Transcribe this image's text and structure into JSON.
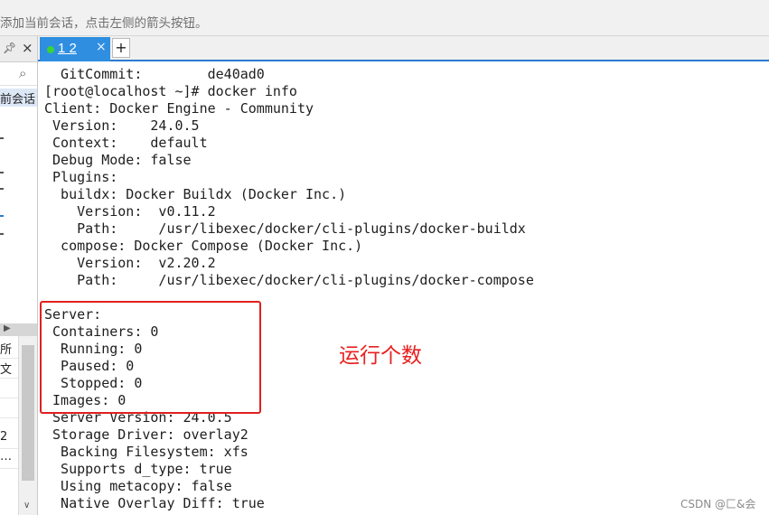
{
  "hint_bar": {
    "text": "添加当前会话，点击左侧的箭头按钮。"
  },
  "left_panel": {
    "pin_icon": "pin-icon",
    "close_glyph": "×",
    "pin_glyph": "▣",
    "search_glyph": "🔍",
    "session_label": "前会话",
    "list_items": [
      "所",
      "文",
      "",
      "",
      "2",
      "…"
    ]
  },
  "tabs": {
    "active_label": "1 2",
    "active_status_color": "#38d438",
    "close_glyph": "×",
    "add_glyph": "+"
  },
  "terminal": {
    "lines": [
      "  GitCommit:        de40ad0",
      "[root@localhost ~]# docker info",
      "Client: Docker Engine - Community",
      " Version:    24.0.5",
      " Context:    default",
      " Debug Mode: false",
      " Plugins:",
      "  buildx: Docker Buildx (Docker Inc.)",
      "    Version:  v0.11.2",
      "    Path:     /usr/libexec/docker/cli-plugins/docker-buildx",
      "  compose: Docker Compose (Docker Inc.)",
      "    Version:  v2.20.2",
      "    Path:     /usr/libexec/docker/cli-plugins/docker-compose",
      "",
      "Server:",
      " Containers: 0",
      "  Running: 0",
      "  Paused: 0",
      "  Stopped: 0",
      " Images: 0",
      " Server Version: 24.0.5",
      " Storage Driver: overlay2",
      "  Backing Filesystem: xfs",
      "  Supports d_type: true",
      "  Using metacopy: false",
      "  Native Overlay Diff: true"
    ]
  },
  "annotation": {
    "text": "运行个数",
    "color": "#e82020"
  },
  "watermark": {
    "text": "CSDN @匚&会"
  }
}
